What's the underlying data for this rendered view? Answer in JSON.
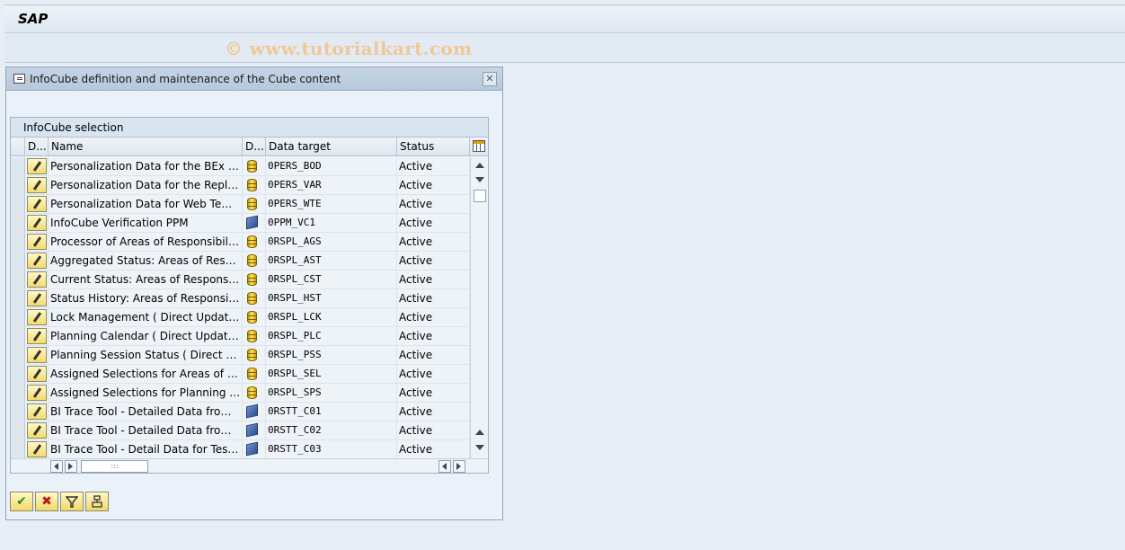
{
  "app": {
    "title": "SAP",
    "watermark": "© www.tutorialkart.com"
  },
  "dialog": {
    "title": "InfoCube definition and maintenance of the Cube content",
    "grid": {
      "title": "InfoCube selection",
      "columns": [
        "D...",
        "Name",
        "D...",
        "Data target",
        "Status"
      ],
      "rows": [
        {
          "name": "Personalization Data for the BEx Open...",
          "icon": "database-icon",
          "target": "0PERS_BOD",
          "status": "Active"
        },
        {
          "name": "Personalization Data for the Replacem...",
          "icon": "database-icon",
          "target": "0PERS_VAR",
          "status": "Active"
        },
        {
          "name": "Personalization Data for Web Templat...",
          "icon": "database-icon",
          "target": "0PERS_WTE",
          "status": "Active"
        },
        {
          "name": "InfoCube Verification PPM",
          "icon": "cube-icon",
          "target": "0PPM_VC1",
          "status": "Active"
        },
        {
          "name": "Processor of Areas of Responsibility ( ...",
          "icon": "database-icon",
          "target": "0RSPL_AGS",
          "status": "Active"
        },
        {
          "name": "Aggregated Status: Areas of Responsi...",
          "icon": "database-icon",
          "target": "0RSPL_AST",
          "status": "Active"
        },
        {
          "name": "Current Status: Areas of Responsibility...",
          "icon": "database-icon",
          "target": "0RSPL_CST",
          "status": "Active"
        },
        {
          "name": "Status History: Areas of Responsibility ...",
          "icon": "database-icon",
          "target": "0RSPL_HST",
          "status": "Active"
        },
        {
          "name": "Lock Management ( Direct Update )",
          "icon": "database-icon",
          "target": "0RSPL_LCK",
          "status": "Active"
        },
        {
          "name": "Planning Calendar ( Direct Update )",
          "icon": "database-icon",
          "target": "0RSPL_PLC",
          "status": "Active"
        },
        {
          "name": "Planning Session Status ( Direct Upda...",
          "icon": "database-icon",
          "target": "0RSPL_PSS",
          "status": "Active"
        },
        {
          "name": "Assigned Selections for Areas of Resp...",
          "icon": "database-icon",
          "target": "0RSPL_SEL",
          "status": "Active"
        },
        {
          "name": "Assigned Selections for Planning Sessi...",
          "icon": "database-icon",
          "target": "0RSPL_SPS",
          "status": "Active"
        },
        {
          "name": "BI Trace Tool - Detailed Data from Te...",
          "icon": "cube-icon",
          "target": "0RSTT_C01",
          "status": "Active"
        },
        {
          "name": "BI Trace Tool - Detailed Data from th...",
          "icon": "cube-icon",
          "target": "0RSTT_C02",
          "status": "Active"
        },
        {
          "name": "BI Trace Tool - Detail Data for Test E...",
          "icon": "cube-icon",
          "target": "0RSTT_C03",
          "status": "Active"
        }
      ]
    },
    "buttons": {
      "ok": "✔",
      "cancel": "✖"
    }
  }
}
